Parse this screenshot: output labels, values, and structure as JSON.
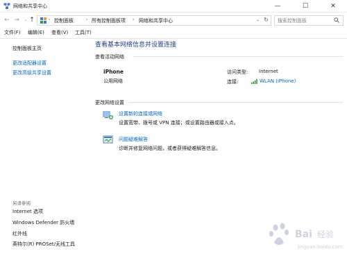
{
  "window": {
    "title": "网络和共享中心",
    "minimize": "—",
    "maximize": "☐",
    "close": "✕"
  },
  "address": {
    "back": "←",
    "forward": "→",
    "recent": "⌄",
    "up": "↑",
    "separator": "›",
    "breadcrumbs": [
      "控制面板",
      "所有控制面板项",
      "网络和共享中心"
    ],
    "dropdown": "⌄",
    "refresh": "↻",
    "search_placeholder": "搜索控制面板"
  },
  "menu": {
    "items": [
      "文件(F)",
      "编辑(E)",
      "查看(V)",
      "工具(T)"
    ]
  },
  "sidebar": {
    "home": "控制面板主页",
    "links": [
      "更改适配器设置",
      "更改高级共享设置"
    ],
    "see_also_title": "另请参阅",
    "see_also": [
      "Internet 选项",
      "Windows Defender 防火墙",
      "红外线",
      "英特尔(R) PROSet/无线工具"
    ]
  },
  "main": {
    "title": "查看基本网络信息并设置连接",
    "active_networks_title": "查看活动网络",
    "network": {
      "name": "iPhone",
      "type": "公用网络",
      "access_type_label": "访问类型:",
      "access_type_value": "Internet",
      "connection_label": "连接:",
      "connection_value": "WLAN (iPhone)"
    },
    "change_settings_title": "更改网络设置",
    "tasks": [
      {
        "icon": "network-setup-icon",
        "label": "设置新的连接或网络",
        "description": "设置宽带、拨号或 VPN 连接；或设置路由器或接入点。"
      },
      {
        "icon": "troubleshoot-icon",
        "label": "问题疑难解答",
        "description": "诊断并修复网络问题，或者获得疑难解答信息。"
      }
    ]
  },
  "colors": {
    "link": "#0066cc",
    "title": "#1e3f94",
    "signal": "#2e9e3a"
  }
}
